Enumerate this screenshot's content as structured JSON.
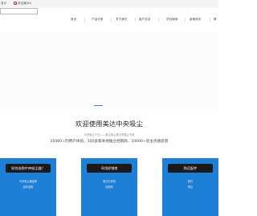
{
  "topbar": {
    "left_text": "显示",
    "weibo_label": "关注我(Sl)"
  },
  "search": {
    "placeholder": ""
  },
  "nav": {
    "items": [
      "首页",
      "产品分类",
      "关于我们",
      "客户支持",
      "项目案例",
      "新闻资讯",
      "联"
    ]
  },
  "banner": {
    "active_slide": 1
  },
  "intro": {
    "title": "欢迎使用美达中央吸尘",
    "subtitle": "中央吸尘产业——美达用心做中央吸尘专家",
    "stats": "25000+的用户体验、100多家本地独立经销商、10000+房主优质反馈"
  },
  "cards": [
    {
      "label": "如何选购中央吸尘器？",
      "lines": [
        "中央吸尘器选购",
        "如何选购"
      ]
    },
    {
      "label": "寻找经销商",
      "lines": [
        "美达中央吸",
        "经销商"
      ]
    },
    {
      "label": "购买配件",
      "lines": [
        "配件",
        "购买"
      ]
    }
  ],
  "colors": {
    "accent": "#1d7fd6",
    "button": "#1a1a1a",
    "indicator": "#3a8ad8"
  }
}
